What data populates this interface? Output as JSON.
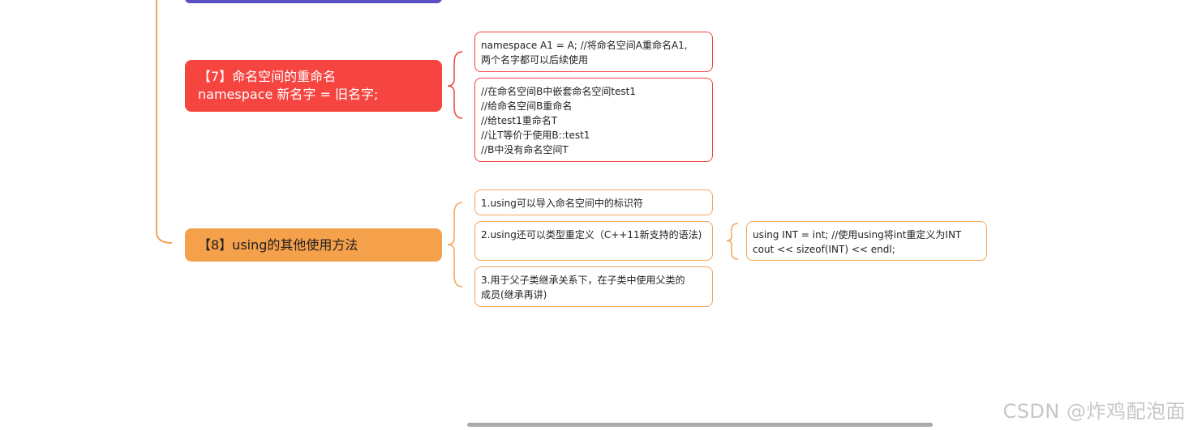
{
  "topics": {
    "seven": {
      "line1": "【7】命名空间的重命名",
      "line2": "namespace 新名字 = 旧名字;"
    },
    "eight": {
      "label": "【8】using的其他使用方法"
    }
  },
  "notes": {
    "seven_a": [
      "namespace A1 = A;   //将命名空间A重命名A1,",
      "两个名字都可以后续使用"
    ],
    "seven_b": [
      "//在命名空间B中嵌套命名空间test1",
      "//给命名空间B重命名",
      "//给test1重命名T",
      "//让T等价于使用B::test1",
      "//B中没有命名空间T"
    ],
    "eight_a": [
      "1.using可以导入命名空间中的标识符"
    ],
    "eight_b": [
      "2.using还可以类型重定义（C++11新支持的语法)"
    ],
    "eight_c": [
      "3.用于父子类继承关系下，在子类中使用父类的",
      "成员(继承再讲)"
    ],
    "eight_d": [
      "using INT = int;   //使用using将int重定义为INT",
      "cout << sizeof(INT) << endl;"
    ]
  },
  "watermark": "CSDN @炸鸡配泡面",
  "colors": {
    "topic_top": "#5a4fc4",
    "topic_seven": "#f64541",
    "topic_eight": "#f5a04b",
    "branch_orange": "#f2a65a",
    "branch_red": "#ef4444"
  }
}
